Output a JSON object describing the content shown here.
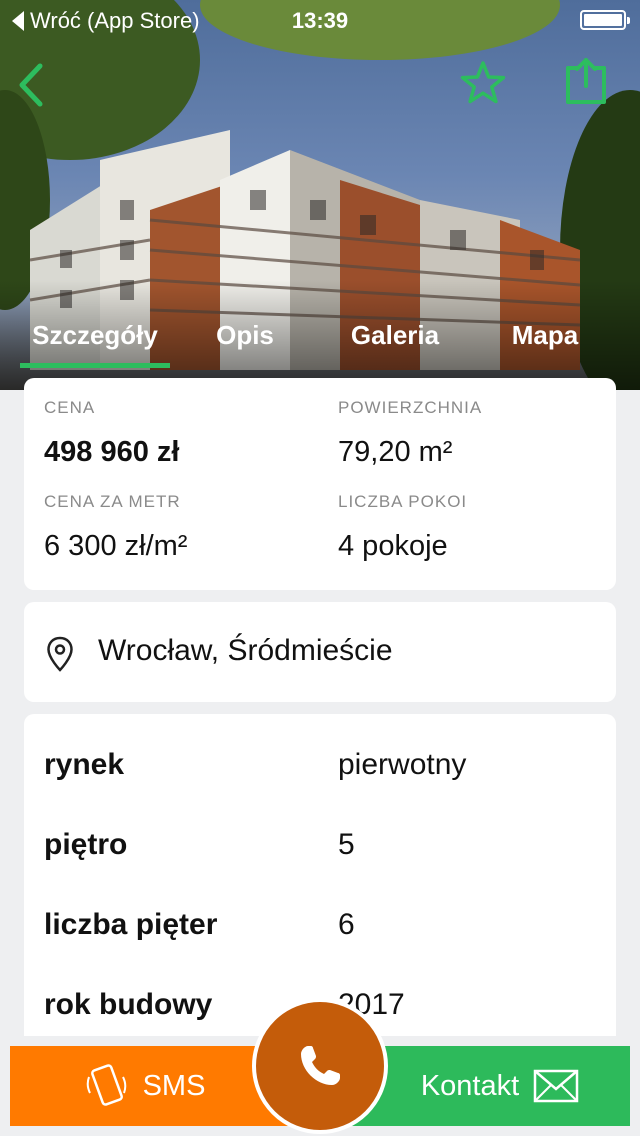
{
  "status_bar": {
    "back_label": "Wróć (App Store)",
    "time": "13:39"
  },
  "nav": {
    "back_icon": "chevron-left-icon",
    "favorite_icon": "star-icon",
    "share_icon": "share-icon"
  },
  "tabs": [
    {
      "label": "Szczegóły",
      "active": true
    },
    {
      "label": "Opis",
      "active": false
    },
    {
      "label": "Galeria",
      "active": false
    },
    {
      "label": "Mapa",
      "active": false
    }
  ],
  "summary": {
    "price_label": "CENA",
    "price_value": "498 960 zł",
    "area_label": "POWIERZCHNIA",
    "area_value": "79,20 m²",
    "price_per_m_label": "CENA ZA METR",
    "price_per_m_value": "6 300 zł/m²",
    "rooms_label": "LICZBA POKOI",
    "rooms_value": "4 pokoje"
  },
  "location": {
    "icon": "location-pin-icon",
    "text": "Wrocław, Śródmieście"
  },
  "details": [
    {
      "key": "rynek",
      "value": "pierwotny"
    },
    {
      "key": "piętro",
      "value": "5"
    },
    {
      "key": "liczba pięter",
      "value": "6"
    },
    {
      "key": "rok budowy",
      "value": "2017"
    }
  ],
  "actions": {
    "sms_label": "SMS",
    "contact_label": "Kontakt",
    "call_icon": "phone-icon"
  },
  "colors": {
    "accent_green": "#2dbd5e",
    "sms_orange": "#ff7a00",
    "call_brown": "#c45c0a"
  }
}
